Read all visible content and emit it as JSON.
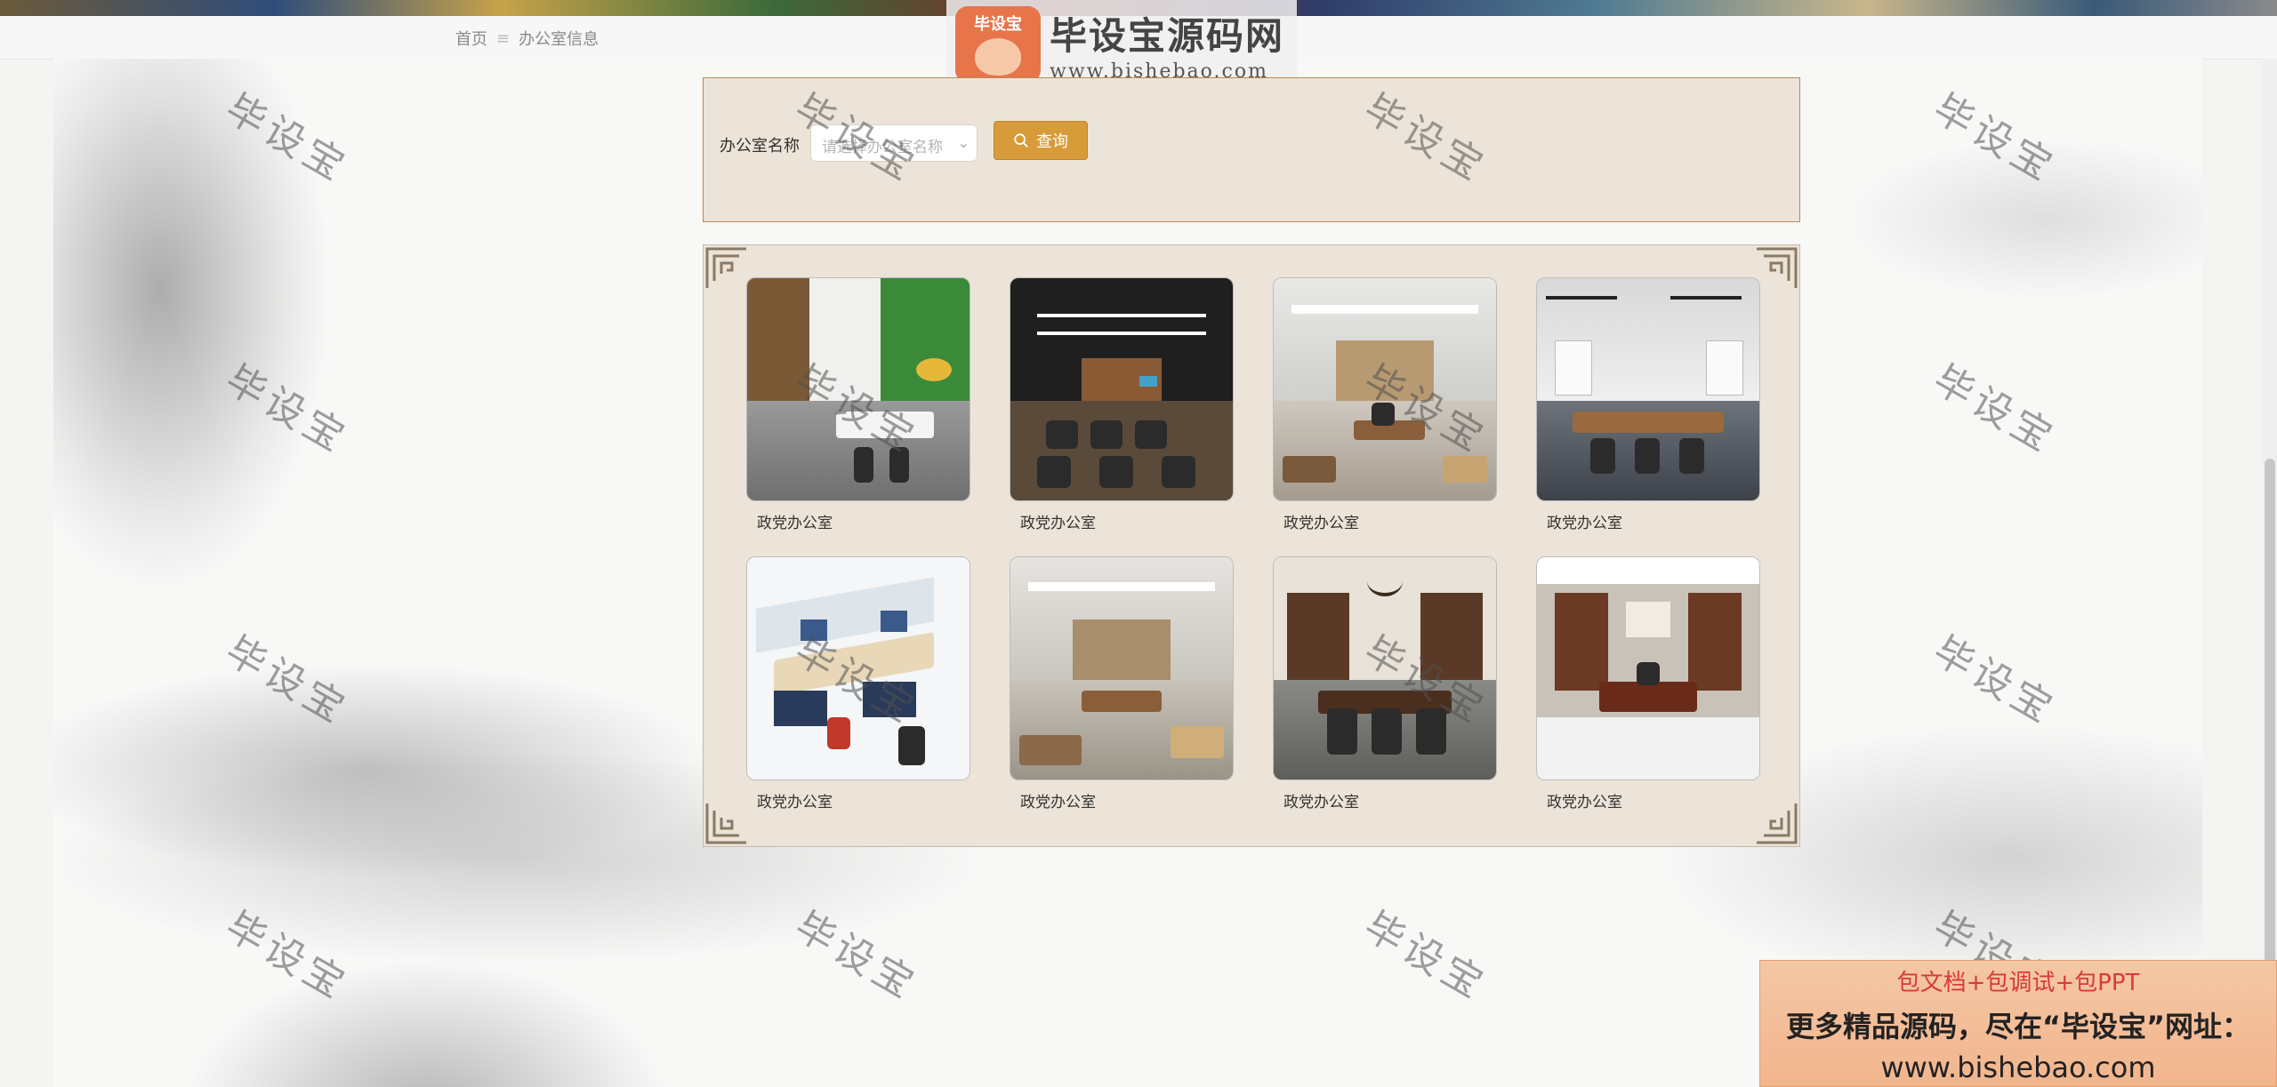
{
  "breadcrumb": {
    "home": "首页",
    "separator": "≡",
    "current": "办公室信息"
  },
  "logo": {
    "badge_text": "毕设宝",
    "title": "毕设宝源码网",
    "url": "www.bishebao.com"
  },
  "search": {
    "label": "办公室名称",
    "placeholder": "请选择办公室名称",
    "button_label": "查询"
  },
  "offices": [
    {
      "name": "政党办公室"
    },
    {
      "name": "政党办公室"
    },
    {
      "name": "政党办公室"
    },
    {
      "name": "政党办公室"
    },
    {
      "name": "政党办公室"
    },
    {
      "name": "政党办公室"
    },
    {
      "name": "政党办公室"
    },
    {
      "name": "政党办公室"
    }
  ],
  "watermark": "毕设宝",
  "promo": {
    "line1": "包文档+包调试+包PPT",
    "line2": "更多精品源码，尽在“毕设宝”网址：",
    "line3": "www.bishebao.com"
  },
  "colors": {
    "accent": "#d79b3a",
    "panel_bg": "#ece4d8",
    "panel_border": "#b78a5a"
  }
}
